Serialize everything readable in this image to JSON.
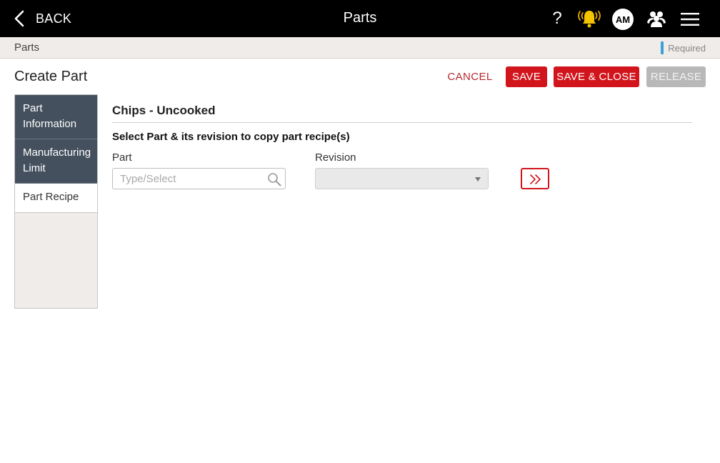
{
  "header": {
    "back_label": "BACK",
    "title": "Parts",
    "help_label": "?",
    "avatar_initials": "AM",
    "icons": [
      "chevron-left-icon",
      "help-icon",
      "notification-bell-icon",
      "users-icon",
      "hamburger-menu-icon"
    ],
    "bell_color": "#f5c400"
  },
  "breadcrumb": {
    "label": "Parts",
    "required_label": "Required",
    "required_color": "#3aa0d8"
  },
  "page": {
    "title": "Create Part"
  },
  "actions": {
    "cancel_label": "CANCEL",
    "save_label": "SAVE",
    "save_close_label": "SAVE & CLOSE",
    "release_label": "RELEASE"
  },
  "tabs": [
    {
      "label": "Part Information",
      "active": false
    },
    {
      "label": "Manufacturing Limit",
      "active": false
    },
    {
      "label": "Part Recipe",
      "active": true
    }
  ],
  "recipe": {
    "part_name": "Chips - Uncooked",
    "instruction": "Select Part & its revision to copy part recipe(s)",
    "part_label": "Part",
    "part_placeholder": "Type/Select",
    "part_value": "",
    "revision_label": "Revision",
    "revision_value": ""
  },
  "colors": {
    "accent_red": "#d2151c",
    "disabled_gray": "#b8b8b8",
    "sidebar_tab": "#44505e"
  }
}
